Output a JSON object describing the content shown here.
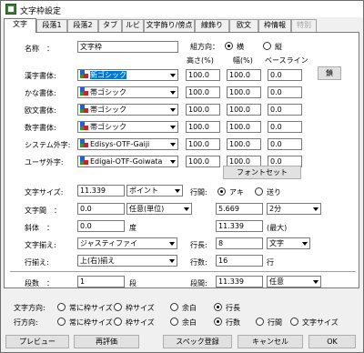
{
  "window": {
    "title": "文字枠設定"
  },
  "tabs": [
    {
      "label": "文字",
      "active": true,
      "disabled": false
    },
    {
      "label": "段落1",
      "active": false,
      "disabled": false
    },
    {
      "label": "段落2",
      "active": false,
      "disabled": false
    },
    {
      "label": "タブ",
      "active": false,
      "disabled": false
    },
    {
      "label": "ルビ",
      "active": false,
      "disabled": false
    },
    {
      "label": "文字飾り/傍点",
      "active": false,
      "disabled": false
    },
    {
      "label": "線飾り",
      "active": false,
      "disabled": false
    },
    {
      "label": "欧文",
      "active": false,
      "disabled": false
    },
    {
      "label": "枠情報",
      "active": false,
      "disabled": false
    },
    {
      "label": "特別",
      "active": false,
      "disabled": true
    }
  ],
  "name": {
    "label": "名称　：",
    "value": "文字枠"
  },
  "kumihoko": {
    "label": "組方向：",
    "yoko": "横",
    "tate": "縦",
    "selected": "yoko"
  },
  "col_headers": {
    "height": "高さ(%)",
    "width": "幅(%)",
    "baseline": "ベースライン"
  },
  "fonts": [
    {
      "label": "漢字書体:",
      "font": "新ゴシック",
      "highlight": true,
      "h": "100.0",
      "w": "100.0",
      "b": "0.0"
    },
    {
      "label": "かな書体:",
      "font": "帯ゴシック",
      "highlight": false,
      "h": "100.0",
      "w": "100.0",
      "b": "0.0"
    },
    {
      "label": "欧文書体:",
      "font": "帯ゴシック",
      "highlight": false,
      "h": "100.0",
      "w": "100.0",
      "b": "0.0"
    },
    {
      "label": "数字書体:",
      "font": "帯ゴシック",
      "highlight": false,
      "h": "100.0",
      "w": "100.0",
      "b": "0.0"
    },
    {
      "label": "システム外字:",
      "font": "Edisys-OTF-Gaiji",
      "highlight": false,
      "h": "100.0",
      "w": "100.0",
      "b": "0.0"
    },
    {
      "label": "ユーザ外字:",
      "font": "Edigai-OTF-Goiwata",
      "highlight": false,
      "h": "100.0",
      "w": "100.0",
      "b": "0.0"
    }
  ],
  "link_button": "鎖",
  "font_set_button": "フォントセット",
  "size": {
    "label": "文字サイズ:",
    "value": "11.339",
    "unit": "ポイント"
  },
  "gyokan": {
    "label": "行間:",
    "aki": "アキ",
    "okuri": "送り",
    "selected": "aki",
    "value": "5.669",
    "unit": "2分"
  },
  "jikan": {
    "label": "文字間　：",
    "value": "0.0",
    "unit": "任意(単位)"
  },
  "shatai": {
    "label": "斜体　：",
    "value": "0.0",
    "unit": "度"
  },
  "gyokan_max": {
    "value": "11.339",
    "note": "(最大)"
  },
  "soroe": {
    "label": "文字揃え:",
    "value": "ジャスティファイ"
  },
  "gyocho": {
    "label": "行長:",
    "value": "8",
    "unit": "文字"
  },
  "gyosoroe": {
    "label": "行揃え:",
    "value": "上(右)揃え"
  },
  "gyosu": {
    "label": "行数:",
    "value": "16",
    "unit": "行"
  },
  "dansu": {
    "label": "段数　：",
    "value": "1",
    "unit": "段"
  },
  "dankan": {
    "label": "段間:",
    "value": "11.339",
    "unit": "任意"
  },
  "text_dir": {
    "label": "文字方向:",
    "options": [
      "常に枠サイズ",
      "枠サイズ",
      "余白",
      "行長"
    ],
    "selected": 3
  },
  "line_dir": {
    "label": "行方向:",
    "options": [
      "常に枠サイズ",
      "枠サイズ",
      "余白",
      "行数",
      "行間",
      "文字サイズ"
    ],
    "selected": 3
  },
  "buttons": {
    "preview": "プレビュー",
    "reeval": "再評価",
    "spec": "スペック登録",
    "cancel": "キャンセル",
    "ok": "OK"
  }
}
